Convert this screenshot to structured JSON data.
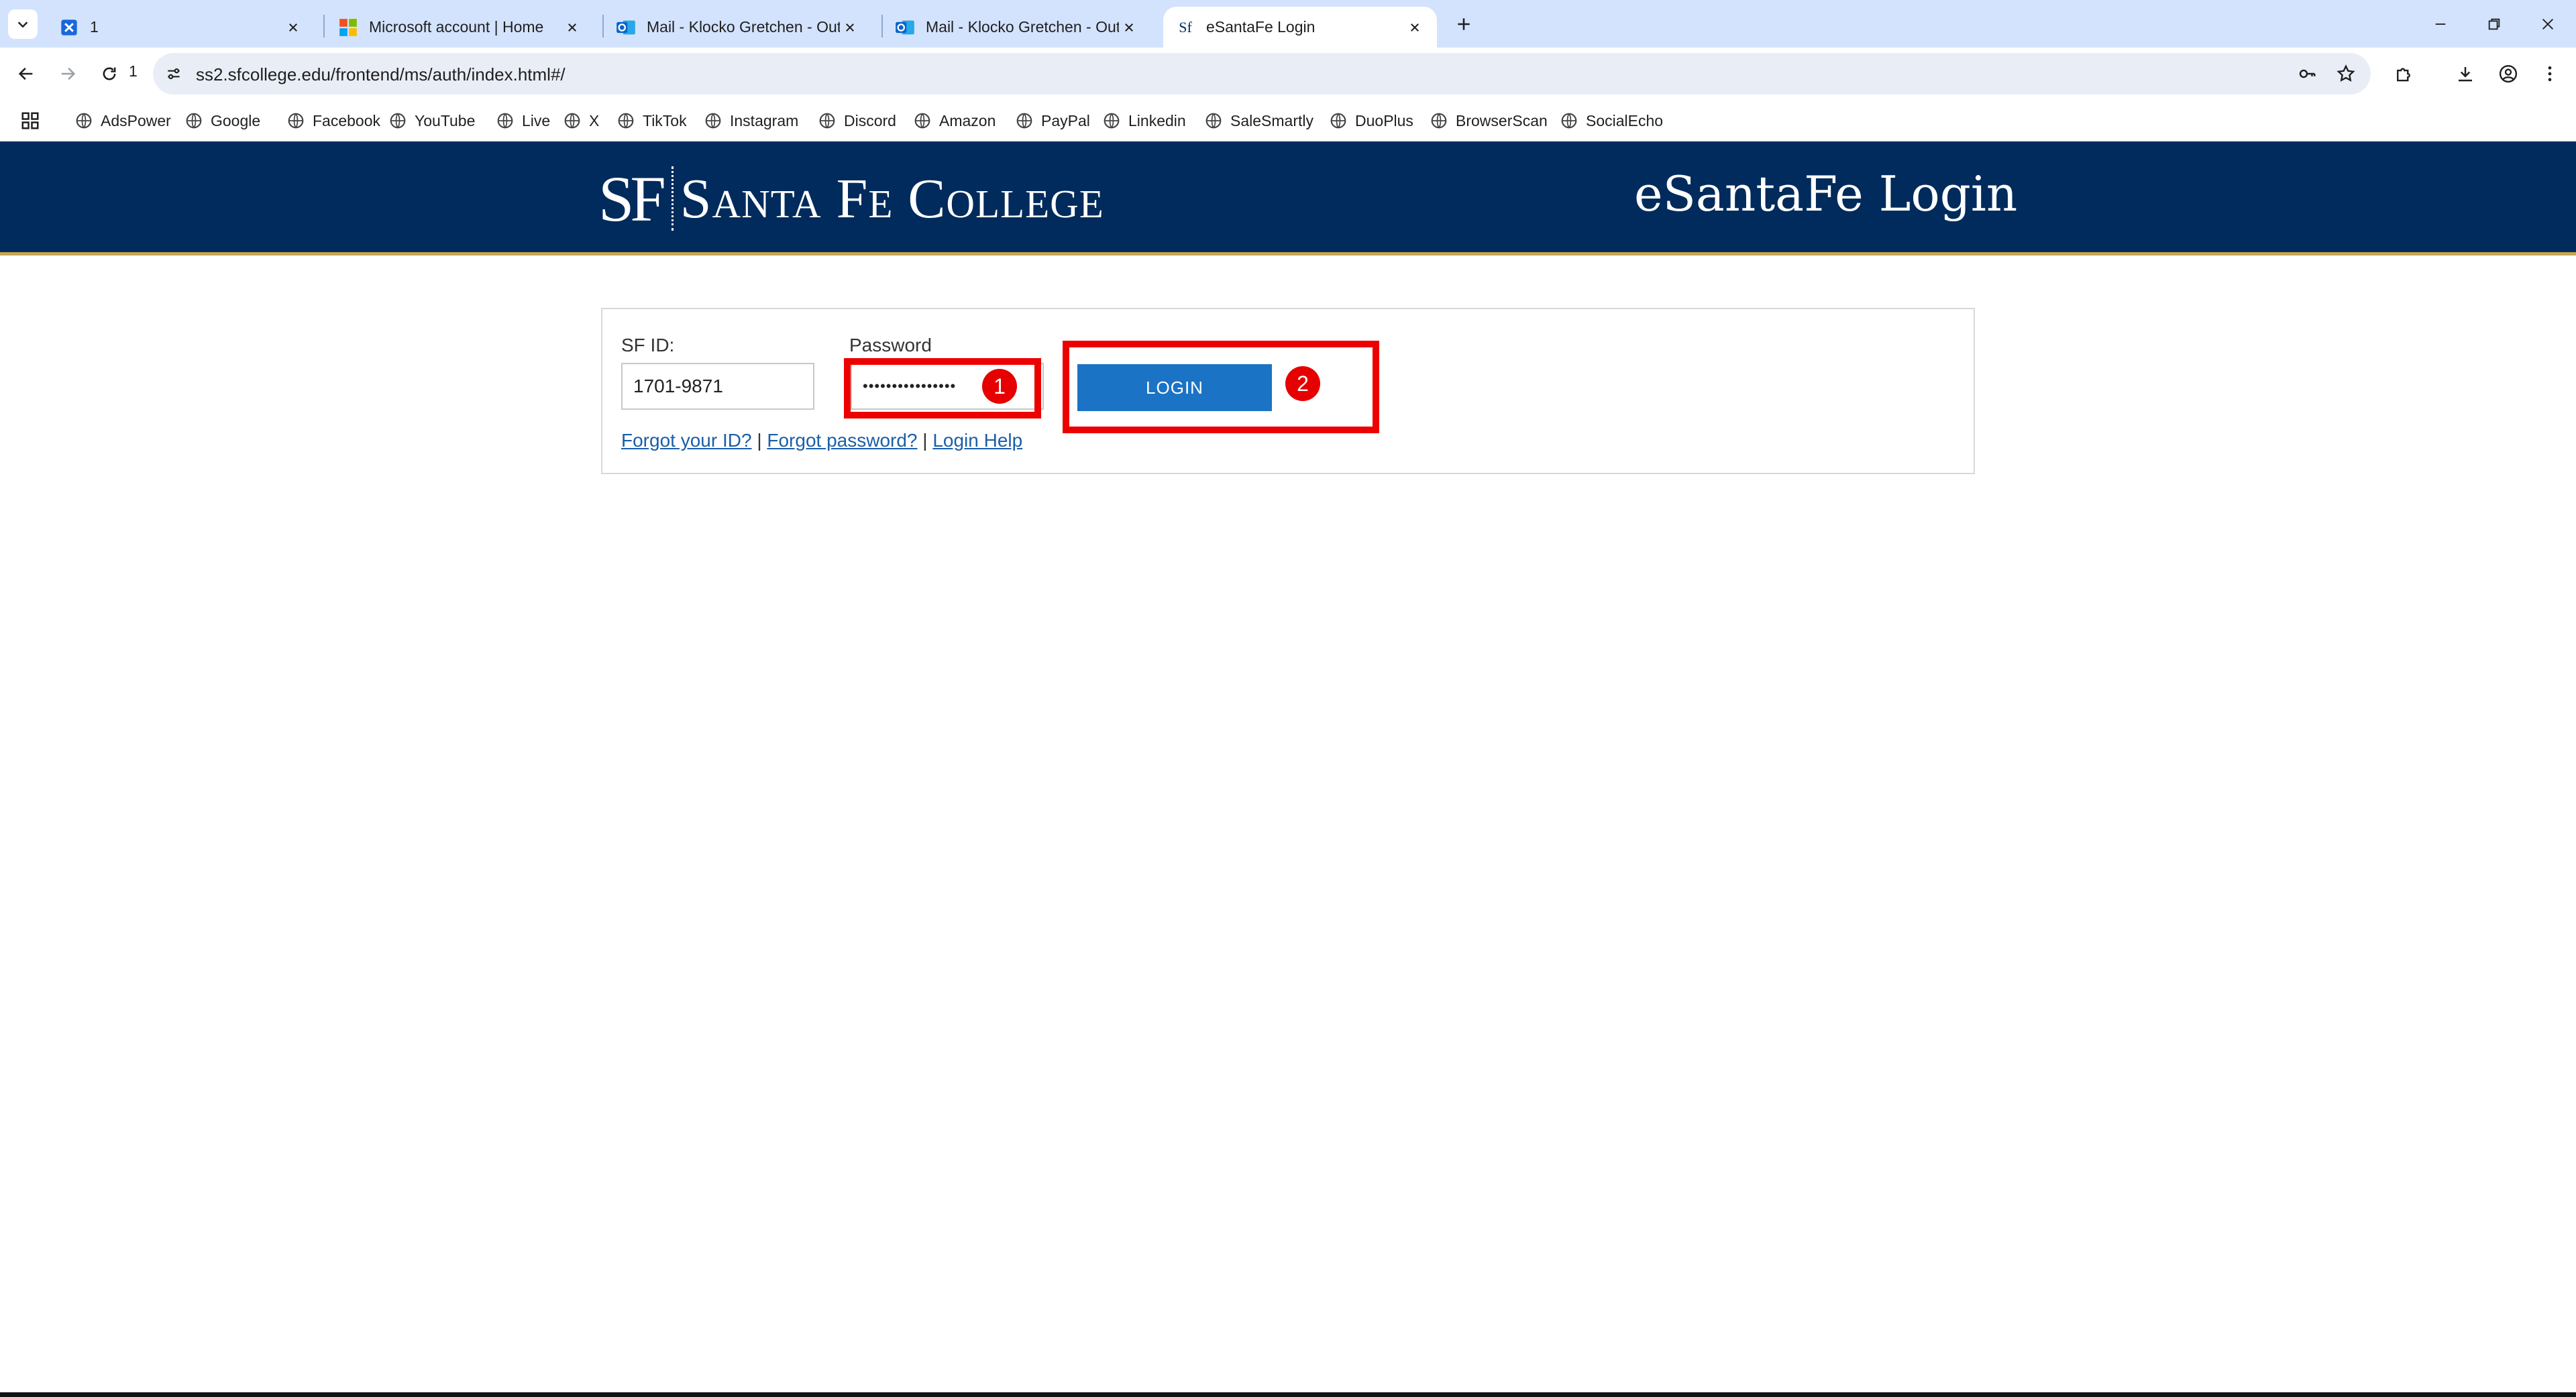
{
  "browser": {
    "tabs": [
      {
        "title": "1",
        "active": false
      },
      {
        "title": "Microsoft account | Home",
        "active": false
      },
      {
        "title": "Mail - Klocko Gretchen - Outlook",
        "active": false
      },
      {
        "title": "Mail - Klocko Gretchen - Outlook",
        "active": false
      },
      {
        "title": "eSantaFe Login",
        "active": true
      }
    ],
    "tab_count": "1",
    "url": "ss2.sfcollege.edu/frontend/ms/auth/index.html#/",
    "bookmarks": [
      "AdsPower",
      "Google",
      "Facebook",
      "YouTube",
      "Live",
      "X",
      "TikTok",
      "Instagram",
      "Discord",
      "Amazon",
      "PayPal",
      "Linkedin",
      "SaleSmartly",
      "DuoPlus",
      "BrowserScan",
      "SocialEcho"
    ],
    "icons": {
      "tab_menu": "chevron-down-icon",
      "new_tab": "plus-icon",
      "back": "arrow-left-icon",
      "forward": "arrow-right-icon",
      "reload": "reload-icon",
      "site_info": "tune-icon",
      "password": "key-icon",
      "bookmark": "star-icon",
      "extensions": "puzzle-icon",
      "downloads": "download-icon",
      "profile": "profile-icon",
      "menu": "kebab-icon"
    }
  },
  "page": {
    "logo_mark": "SF",
    "college_name": "Santa Fe College",
    "portal_title": "eSantaFe Login",
    "form": {
      "sfid_label": "SF ID:",
      "sfid_value": "1701-9871",
      "password_label": "Password",
      "password_value": "••••••••••••••••",
      "login_button": "LOGIN"
    },
    "links": {
      "forgot_id": "Forgot your ID?",
      "forgot_password": "Forgot password?",
      "login_help": "Login Help",
      "separator": "|"
    }
  },
  "annotations": [
    {
      "label": "1"
    },
    {
      "label": "2"
    }
  ],
  "colors": {
    "header_bg": "#012b5c",
    "header_accent": "#c9a550",
    "button_bg": "#1a73c5",
    "annotation": "#e60000",
    "tabstrip_bg": "#d3e3fd"
  }
}
